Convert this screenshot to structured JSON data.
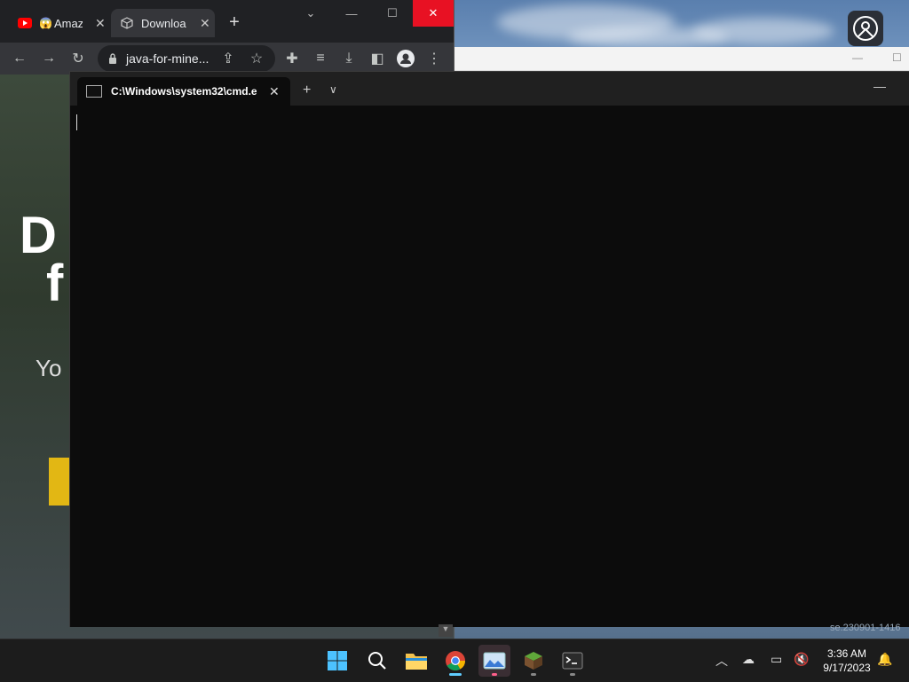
{
  "chrome": {
    "tabs": [
      {
        "label": "Amaz",
        "icon": "youtube-icon"
      },
      {
        "label": "Downloa",
        "icon": "cube-icon"
      }
    ],
    "new_tab": "+",
    "url": "java-for-mine...",
    "page": {
      "heading_line1": "D",
      "heading_line2": "f",
      "subtext": "Yo"
    }
  },
  "terminal": {
    "tab_title": "C:\\Windows\\system32\\cmd.e:",
    "new_tab": "+",
    "dropdown": "⌄"
  },
  "behind_status": "se.230901-1416",
  "taskbar": {
    "apps": [
      "windows-start",
      "search",
      "file-explorer",
      "chrome",
      "photos",
      "minecraft",
      "terminal"
    ],
    "clock_time": "3:36 AM",
    "clock_date": "9/17/2023"
  },
  "colors": {
    "close_red": "#e81123",
    "accent_blue": "#60cdff",
    "terminal_bg": "#0c0c0c"
  }
}
